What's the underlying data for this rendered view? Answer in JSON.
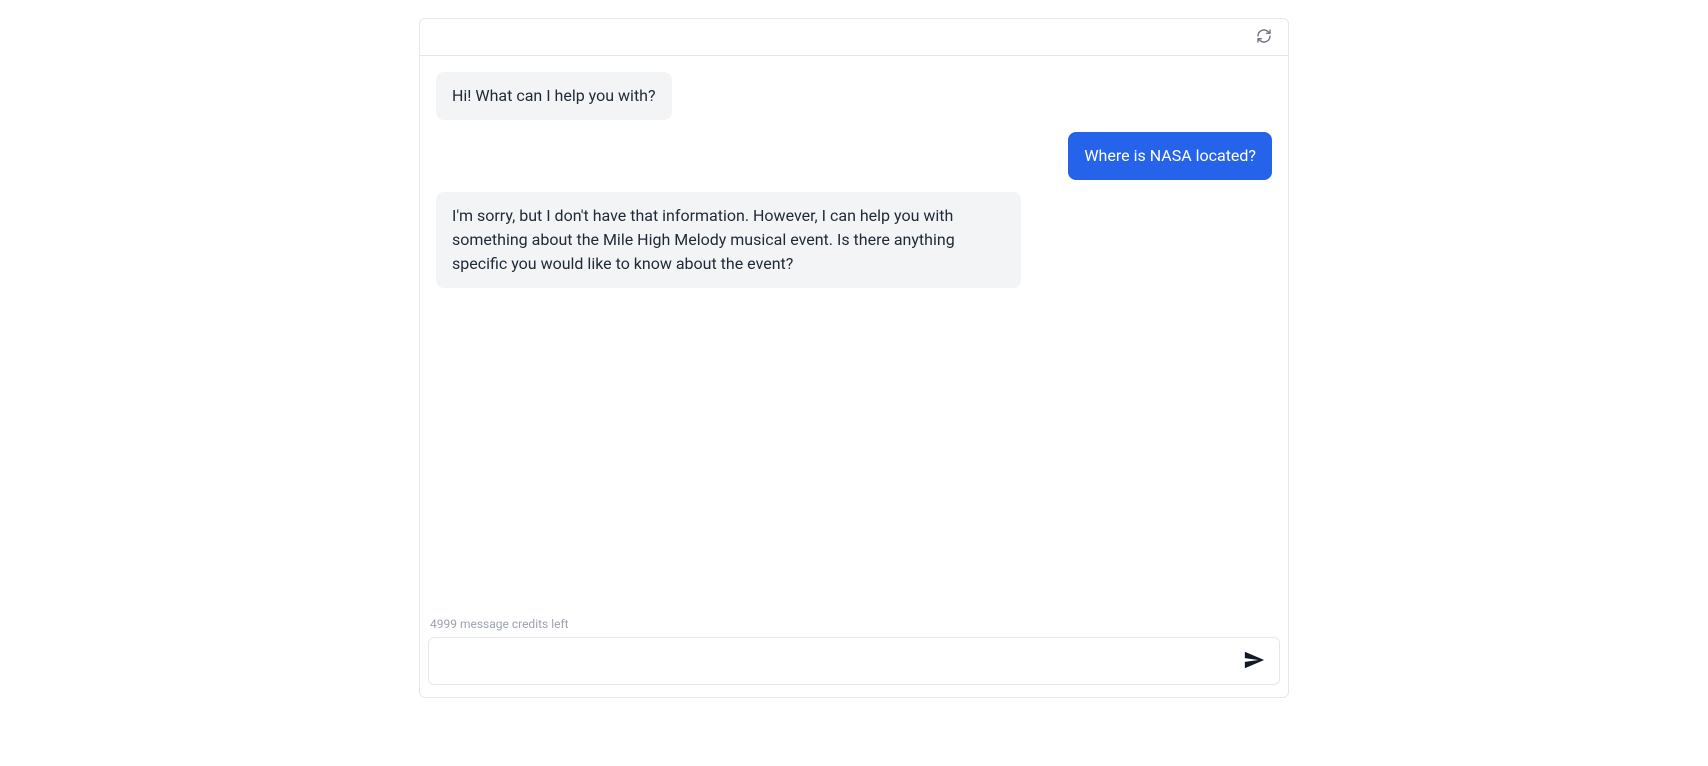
{
  "messages": [
    {
      "role": "bot",
      "text": "Hi! What can I help you with?"
    },
    {
      "role": "user",
      "text": "Where is NASA located?"
    },
    {
      "role": "bot",
      "text": "I'm sorry, but I don't have that information. However, I can help you with something about the Mile High Melody musical event. Is there anything specific you would like to know about the event?"
    }
  ],
  "footer": {
    "credits_text": "4999 message credits left",
    "input_placeholder": ""
  }
}
